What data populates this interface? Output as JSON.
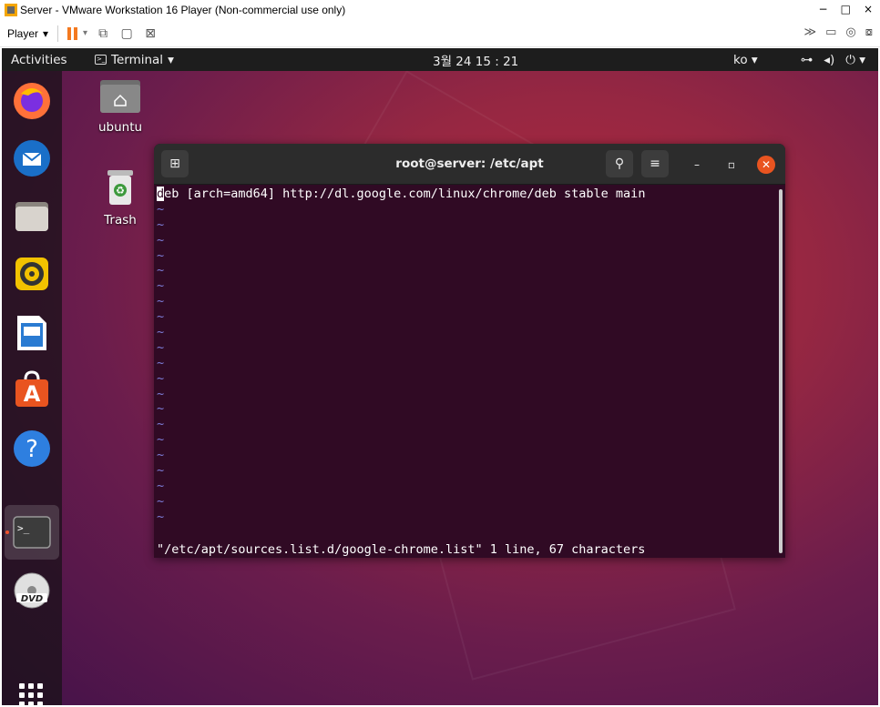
{
  "vmware": {
    "title": "Server - VMware Workstation 16 Player (Non-commercial use only)",
    "player_label": "Player",
    "win_controls": [
      "−",
      "□",
      "×"
    ]
  },
  "ubuntu": {
    "topbar": {
      "activities": "Activities",
      "app_name": "Terminal",
      "clock": "3월 24  15 : 21",
      "lang": "ko"
    },
    "dock": [
      {
        "name": "firefox-icon",
        "color": "#ff7139"
      },
      {
        "name": "thunderbird-icon",
        "color": "#1a6fc8"
      },
      {
        "name": "files-icon",
        "color": "#b9b4ae"
      },
      {
        "name": "rhythmbox-icon",
        "color": "#f2c200"
      },
      {
        "name": "libreoffice-writer-icon",
        "color": "#2a7bd2"
      },
      {
        "name": "ubuntu-software-icon",
        "color": "#e95420"
      },
      {
        "name": "help-icon",
        "color": "#2e7fe0"
      },
      {
        "name": "terminal-icon",
        "color": "#3c3c3c"
      },
      {
        "name": "dvd-icon",
        "color": "#dddddd"
      }
    ],
    "desktop": {
      "home_label": "ubuntu",
      "trash_label": "Trash"
    }
  },
  "terminal": {
    "title": "root@server: /etc/apt",
    "line1_first": "d",
    "line1_rest": "eb [arch=amd64] http://dl.google.com/linux/chrome/deb stable main",
    "tilde": "~",
    "status": "\"/etc/apt/sources.list.d/google-chrome.list\" 1 line, 67 characters"
  }
}
